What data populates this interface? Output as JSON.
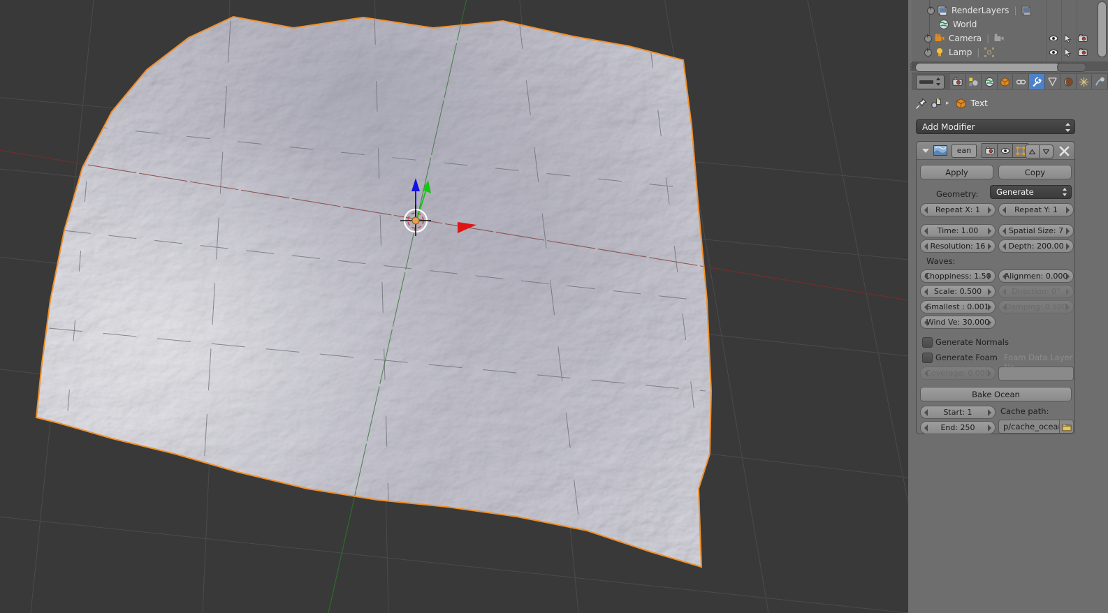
{
  "viewport": {
    "name": "3d-viewport",
    "background_color": "#393939",
    "grid_color": "#4a4a4a",
    "x_axis_color": "#7a3030",
    "y_axis_color": "#2f6b2f",
    "object_outline_color": "#f0902a",
    "mesh_light_color": "#d3d2da",
    "mesh_dark_color": "#8d8d9c",
    "manipulator": {
      "z_arrow_color": "#1414e0",
      "y_arrow_color": "#14c814",
      "x_arrow_color": "#e01414"
    },
    "cursor_name": "3d-cursor"
  },
  "outliner": {
    "name": "outliner",
    "rows": [
      {
        "label": "RenderLayers",
        "icon": "renderlayers-icon",
        "expandable": true,
        "has_data_icon": true,
        "show_toggles": false
      },
      {
        "label": "World",
        "icon": "world-icon",
        "expandable": false,
        "has_data_icon": false,
        "show_toggles": false
      },
      {
        "label": "Camera",
        "icon": "camera-object-icon",
        "expandable": true,
        "has_data_icon": true,
        "show_toggles": true
      },
      {
        "label": "Lamp",
        "icon": "lamp-object-icon",
        "expandable": true,
        "has_data_icon": true,
        "show_toggles": true
      }
    ],
    "toggle_icons": [
      "eye-icon",
      "cursor-select-icon",
      "render-camera-icon"
    ],
    "scrollbar_name": "outliner-horizontal-scrollbar"
  },
  "properties": {
    "tabs": [
      {
        "name": "tab-render",
        "icon": "render-camera-icon",
        "active": false
      },
      {
        "name": "tab-scene",
        "icon": "scene-icon",
        "active": false
      },
      {
        "name": "tab-world",
        "icon": "world-icon",
        "active": false
      },
      {
        "name": "tab-object",
        "icon": "object-cube-icon",
        "active": false
      },
      {
        "name": "tab-constraints",
        "icon": "chain-link-icon",
        "active": false
      },
      {
        "name": "tab-modifiers",
        "icon": "wrench-icon",
        "active": true
      },
      {
        "name": "tab-particles",
        "icon": "particles-icon",
        "active": false
      },
      {
        "name": "tab-physics",
        "icon": "physics-icon",
        "active": false
      },
      {
        "name": "tab-object-data",
        "icon": "mesh-data-icon",
        "active": false
      },
      {
        "name": "tab-material",
        "icon": "material-sphere-icon",
        "active": false
      }
    ],
    "active_tab_color": "#4d82c8",
    "breadcrumb": {
      "pin_icon": "pin-icon",
      "object_icon": "object-data-icon",
      "separator": "▸",
      "object_name": "Text"
    },
    "add_modifier_label": "Add Modifier",
    "modifier": {
      "header": {
        "collapse_icon": "triangle-down-icon",
        "type_icon": "ocean-modifier-icon",
        "name_value": "ean",
        "toggles": [
          {
            "name": "render-toggle",
            "icon": "render-camera-icon",
            "on": true
          },
          {
            "name": "realtime-toggle",
            "icon": "eye-icon",
            "on": true
          },
          {
            "name": "editmode-toggle",
            "icon": "edit-mode-icon",
            "on": true
          }
        ],
        "move_up_icon": "triangle-up-icon",
        "move_down_icon": "triangle-down-icon",
        "close_icon": "x-close-icon"
      },
      "apply_label": "Apply",
      "copy_label": "Copy",
      "geometry_label": "Geometry:",
      "geometry_value": "Generate",
      "fields": [
        {
          "label": "Repeat X: 1",
          "disabled": false
        },
        {
          "label": "Repeat Y: 1",
          "disabled": false
        },
        {
          "label": "Time: 1.00",
          "disabled": false
        },
        {
          "label": "Spatial Size: 7",
          "disabled": false
        },
        {
          "label": "Resolution: 16",
          "disabled": false
        },
        {
          "label": "Depth: 200.00",
          "disabled": false
        }
      ],
      "waves_label": "Waves:",
      "wave_fields": [
        {
          "label": "Choppiness: 1.50",
          "disabled": false
        },
        {
          "label": "Alignmen: 0.000",
          "disabled": false
        },
        {
          "label": "Scale: 0.500",
          "disabled": false
        },
        {
          "label": "Direction: 0°",
          "disabled": true
        },
        {
          "label": "Smallest : 0.001",
          "disabled": false
        },
        {
          "label": "Damping: 0.500",
          "disabled": true
        },
        {
          "label": "Wind Ve: 30.000",
          "disabled": false
        }
      ],
      "generate_normals_label": "Generate Normals",
      "generate_normals_checked": false,
      "generate_foam_label": "Generate Foam",
      "generate_foam_checked": false,
      "foam_layer_label": "Foam Data Layer Na",
      "foam_layer_value": "",
      "coverage_label": "Coverage: 0.000",
      "bake_ocean_label": "Bake Ocean",
      "start_label": "Start: 1",
      "end_label": "End: 250",
      "cache_path_label": "Cache path:",
      "cache_path_value": "p/cache_ocean",
      "cache_path_browse_icon": "folder-icon"
    }
  }
}
